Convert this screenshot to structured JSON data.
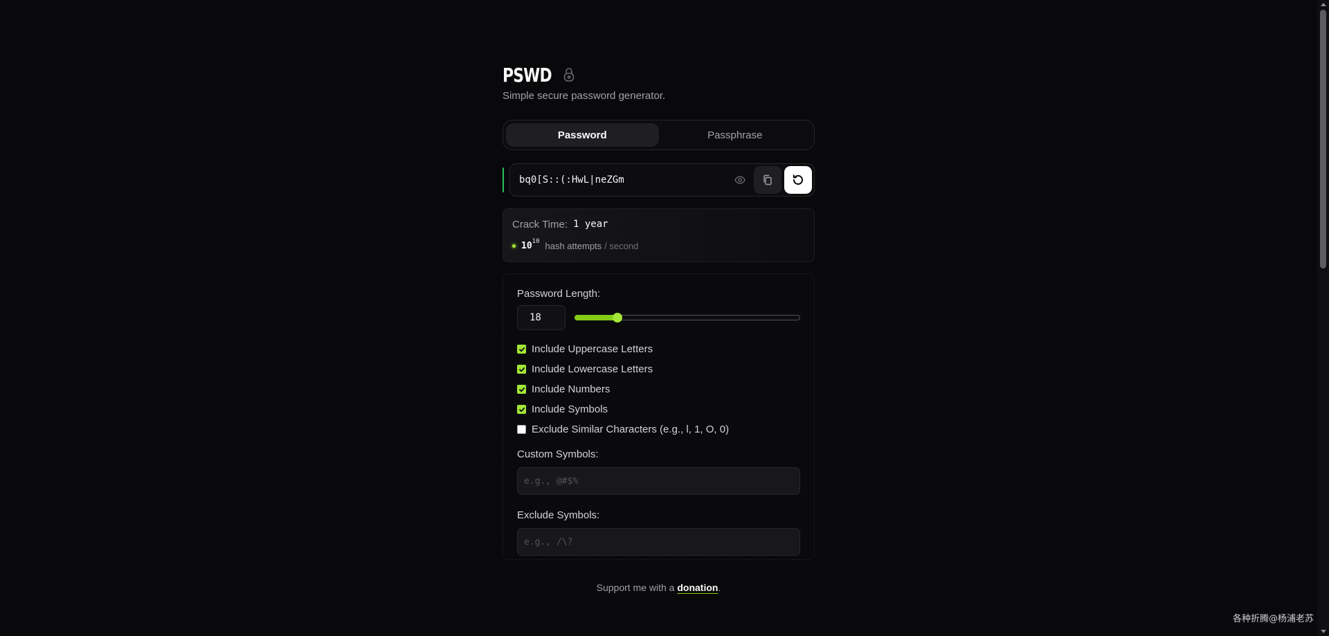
{
  "header": {
    "title": "PSWD",
    "subtitle": "Simple secure password generator.",
    "icon": "lock-icon"
  },
  "tabs": [
    {
      "label": "Password",
      "active": true
    },
    {
      "label": "Passphrase",
      "active": false
    }
  ],
  "password": {
    "value": "bq0[S::(:HwL|neZGm",
    "icons": [
      "eye-icon",
      "copy-icon",
      "regenerate-icon"
    ]
  },
  "crack": {
    "label": "Crack Time:",
    "value": "1 year",
    "rate_base": "10",
    "rate_exponent": "10",
    "rate_label": "hash attempts",
    "rate_per": "/ second"
  },
  "settings": {
    "length_label": "Password Length:",
    "length_value": "18",
    "length_fraction": 0.19,
    "options": [
      {
        "label": "Include Uppercase Letters",
        "checked": true
      },
      {
        "label": "Include Lowercase Letters",
        "checked": true
      },
      {
        "label": "Include Numbers",
        "checked": true
      },
      {
        "label": "Include Symbols",
        "checked": true
      },
      {
        "label": "Exclude Similar Characters (e.g., l, 1, O, 0)",
        "checked": false
      }
    ],
    "custom_symbols_label": "Custom Symbols:",
    "custom_symbols_placeholder": "e.g., @#$%",
    "exclude_symbols_label": "Exclude Symbols:",
    "exclude_symbols_placeholder": "e.g., /\\?"
  },
  "footer": {
    "prefix": "Support me with a ",
    "link": "donation",
    "suffix": "."
  },
  "watermark": "各种折腾@杨浦老苏",
  "colors": {
    "accent": "#a3e635",
    "accent_bar": "#22c55e",
    "background": "#09090b"
  }
}
